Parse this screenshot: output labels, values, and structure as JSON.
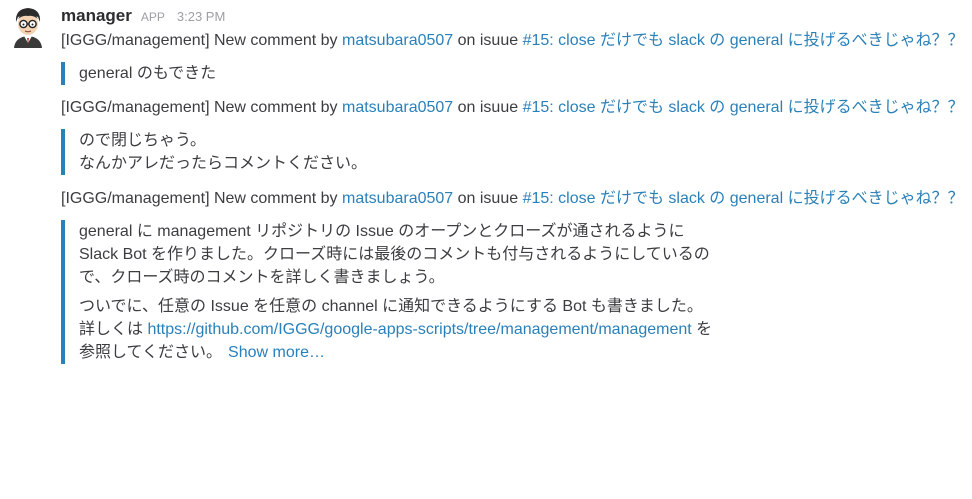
{
  "message": {
    "sender": "manager",
    "badge": "APP",
    "time": "3:23 PM"
  },
  "notifications": [
    {
      "prefix": "[IGGG/management] New comment by ",
      "user": "matsubara0507",
      "middle": " on isuue ",
      "issue": "#15: close だけでも slack の general に投げるべきじゃね？？",
      "comment": "general のもできた"
    },
    {
      "prefix": "[IGGG/management] New comment by ",
      "user": "matsubara0507",
      "middle": " on isuue ",
      "issue": "#15: close だけでも slack の general に投げるべきじゃね？？",
      "comment_line1": "ので閉じちゃう。",
      "comment_line2": "なんかアレだったらコメントください。"
    },
    {
      "prefix": "[IGGG/management] New comment by ",
      "user": "matsubara0507",
      "middle": " on isuue ",
      "issue": "#15: close だけでも slack の general に投げるべきじゃね？？",
      "para1": "general に management リポジトリの Issue のオープンとクローズが通されるように Slack Bot を作りました。クローズ時には最後のコメントも付与されるようにしているので、クローズ時のコメントを詳しく書きましょう。",
      "para2": "ついでに、任意の Issue を任意の channel に通知できるようにする Bot も書きました。",
      "details_prefix": "詳しくは ",
      "details_link": "https://github.com/IGGG/google-apps-scripts/tree/management/management",
      "details_suffix": " を参照してください。",
      "show_more": "Show more…"
    }
  ]
}
